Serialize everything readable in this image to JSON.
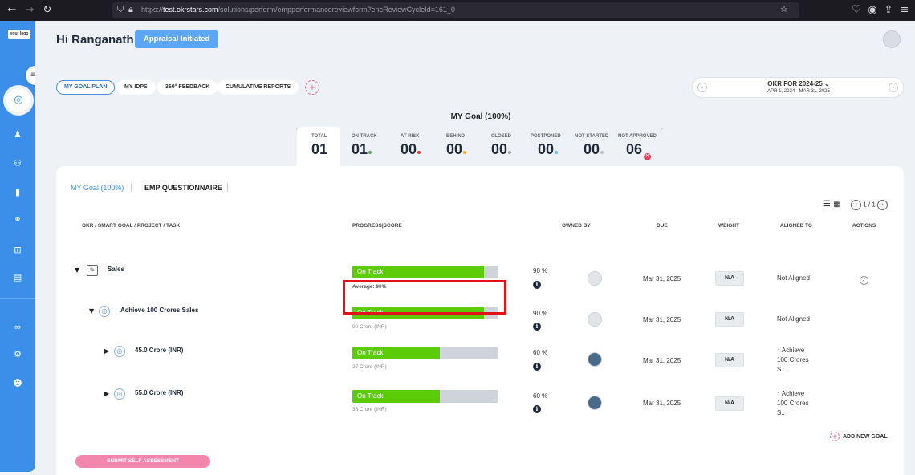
{
  "browser": {
    "url_prefix": "https://",
    "url_domain": "test.okrstars.com",
    "url_path": "/solutions/perform/empperformancereviewform?encReviewCycleId=161_0"
  },
  "sidebar": {
    "logo_text": "your logo"
  },
  "header": {
    "greeting": "Hi Ranganath",
    "status_badge": "Appraisal Initiated"
  },
  "tabs": [
    "MY GOAL PLAN",
    "MY IDPS",
    "360° FEEDBACK",
    "CUMULATIVE REPORTS"
  ],
  "cycle": {
    "title": "OKR FOR 2024-25",
    "range": "APR 1, 2024 - MAR 31, 2025"
  },
  "summary": {
    "title": "MY Goal (100%)",
    "stats": [
      {
        "label": "TOTAL",
        "value": "01",
        "dot": ""
      },
      {
        "label": "ON TRACK",
        "value": "01",
        "dot": "#4caf50"
      },
      {
        "label": "AT RISK",
        "value": "00",
        "dot": "#e53935"
      },
      {
        "label": "BEHIND",
        "value": "00",
        "dot": "#f5a623"
      },
      {
        "label": "CLOSED",
        "value": "00",
        "dot": "#9e9e9e"
      },
      {
        "label": "POSTPONED",
        "value": "00",
        "dot": "#64b5f6"
      },
      {
        "label": "NOT STARTED",
        "value": "00",
        "dot": "#bdbdbd"
      },
      {
        "label": "NOT APPROVED",
        "value": "06",
        "dot": ""
      }
    ]
  },
  "panel": {
    "tab_goal": "MY Goal (100%)",
    "tab_questionnaire": "EMP QUESTIONNAIRE",
    "pager": "1 / 1",
    "columns": {
      "task": "OKR / SMART GOAL / PROJECT / TASK",
      "progress": "PROGRESS|SCORE",
      "owner": "OWNED BY",
      "due": "DUE",
      "weight": "WEIGHT",
      "aligned": "ALIGNED TO",
      "actions": "ACTIONS"
    },
    "rows": [
      {
        "name": "Sales",
        "status": "On Track",
        "progress": 0.9,
        "note": "Average: 90%",
        "score": "90 %",
        "due": "Mar 31, 2025",
        "weight": "N/A",
        "aligned_lines": [
          "Not Aligned"
        ]
      },
      {
        "name": "Achieve 100 Crores Sales",
        "status": "On Track",
        "progress": 0.9,
        "note": "90 Crore (INR)",
        "score": "90 %",
        "due": "Mar 31, 2025",
        "weight": "N/A",
        "aligned_lines": [
          "Not Aligned"
        ]
      },
      {
        "name": "45.0 Crore (INR)",
        "status": "On Track",
        "progress": 0.6,
        "note": "27 Crore (INR)",
        "score": "60 %",
        "due": "Mar 31, 2025",
        "weight": "N/A",
        "aligned_lines": [
          "↑ Achieve",
          "100 Crores",
          "S.."
        ]
      },
      {
        "name": "55.0 Crore (INR)",
        "status": "On Track",
        "progress": 0.6,
        "note": "33 Crore (INR)",
        "score": "60 %",
        "due": "Mar 31, 2025",
        "weight": "N/A",
        "aligned_lines": [
          "↑ Achieve",
          "100 Crores",
          "S.."
        ]
      }
    ],
    "add_goal": "ADD NEW GOAL",
    "submit": "SUBMIT SELF ASSESSMENT"
  },
  "colors": {
    "accent": "#3b8fe8",
    "on_track": "#5ccc09",
    "highlight": "#e0121a"
  }
}
